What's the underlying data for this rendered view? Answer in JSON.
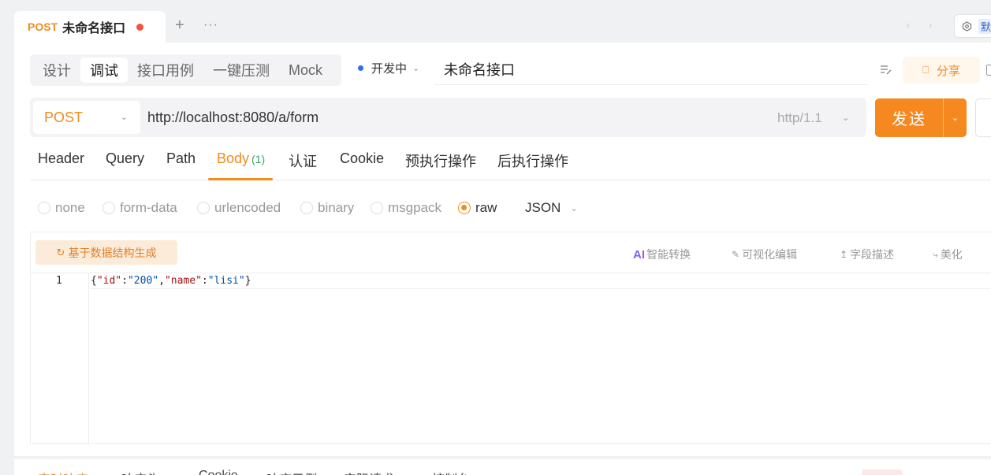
{
  "tabbar": {
    "tab": {
      "method": "POST",
      "title": "未命名接口"
    },
    "add_icon": "+",
    "more_icon": "···",
    "prev_icon": "‹",
    "next_icon": "›",
    "env_label": "默"
  },
  "header": {
    "mode_tabs": [
      "设计",
      "调试",
      "接口用例",
      "一键压测",
      "Mock"
    ],
    "active_mode": "调试",
    "status": "开发中",
    "api_name": "未命名接口",
    "share_label": "分享"
  },
  "request": {
    "method": "POST",
    "url": "http://localhost:8080/a/form",
    "protocol": "http/1.1",
    "send_label": "发送"
  },
  "param_tabs": [
    {
      "label": "Header"
    },
    {
      "label": "Query"
    },
    {
      "label": "Path"
    },
    {
      "label": "Body",
      "count": "(1)",
      "active": true
    },
    {
      "label": "认证"
    },
    {
      "label": "Cookie"
    },
    {
      "label": "预执行操作"
    },
    {
      "label": "后执行操作"
    }
  ],
  "body_types": [
    "none",
    "form-data",
    "urlencoded",
    "binary",
    "msgpack",
    "raw"
  ],
  "active_body_type": "raw",
  "raw_format": "JSON",
  "editor": {
    "generate_label": "基于数据结构生成",
    "tools": {
      "ai_mark": "AI",
      "ai_convert": "智能转换",
      "visual_edit": "可视化编辑",
      "field_desc": "字段描述",
      "beautify": "美化"
    },
    "line_number": "1",
    "code": "{\"id\":\"200\",\"name\":\"lisi\"}",
    "code_parts": [
      "{",
      "\"id\"",
      ":",
      "\"200\"",
      ",",
      "\"name\"",
      ":",
      "\"lisi\"",
      "}"
    ]
  },
  "bottom_panel": {
    "items": [
      "实时响应",
      "响应头",
      "Cookie",
      "响应示例",
      "实际请求",
      "控制台"
    ]
  },
  "colors": {
    "accent": "#f08c1c",
    "send_button": "#f5891f",
    "status_dot": "#2f6cf6",
    "unsaved_dot": "#f5533d",
    "body_count": "#3aa36b"
  }
}
